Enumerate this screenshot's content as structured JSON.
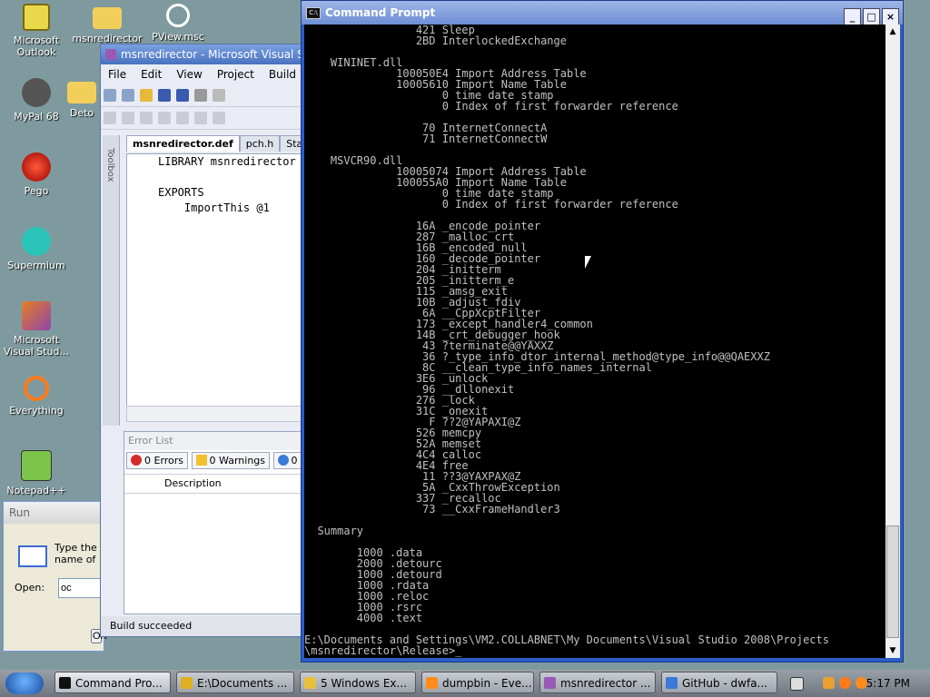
{
  "desktop": {
    "icons": [
      {
        "label": "Microsoft Outlook",
        "name": "outlook"
      },
      {
        "label": "msnredirector",
        "name": "msnredirector-folder"
      },
      {
        "label": "PView.msc",
        "name": "pview"
      },
      {
        "label": "MyPal 68",
        "name": "mypal"
      },
      {
        "label": "Deto",
        "name": "deto"
      },
      {
        "label": "Pego",
        "name": "pego"
      },
      {
        "label": "Supermium",
        "name": "supermium"
      },
      {
        "label": "Microsoft Visual Stud...",
        "name": "visual-studio"
      },
      {
        "label": "Everything",
        "name": "everything"
      },
      {
        "label": "Notepad++",
        "name": "notepadpp"
      }
    ]
  },
  "vs_window": {
    "title": "msnredirector - Microsoft Visual Studio",
    "menu": [
      "File",
      "Edit",
      "View",
      "Project",
      "Build"
    ],
    "toolbox_label": "Toolbox",
    "tabs": [
      "msnredirector.def",
      "pch.h",
      "Start Page"
    ],
    "editor_lines": [
      "LIBRARY msnredirector",
      "",
      "EXPORTS",
      "    ImportThis @1"
    ],
    "error_list": {
      "title": "Error List",
      "errors": "0 Errors",
      "warnings": "0 Warnings",
      "messages": "0",
      "column": "Description"
    },
    "status": "Build succeeded"
  },
  "run_dialog": {
    "title": "Run",
    "text": "Type the name of a program, folder, document, or Internet resource",
    "open_label": "Open:",
    "open_value": "oc",
    "ok_label": "OK"
  },
  "cmd_window": {
    "title": "Command Prompt",
    "icon_text": "C:\\",
    "lines": [
      "                 421 Sleep",
      "                 2BD InterlockedExchange",
      "",
      "    WININET.dll",
      "              100050E4 Import Address Table",
      "              10005610 Import Name Table",
      "                     0 time date stamp",
      "                     0 Index of first forwarder reference",
      "",
      "                  70 InternetConnectA",
      "                  71 InternetConnectW",
      "",
      "    MSVCR90.dll",
      "              10005074 Import Address Table",
      "              100055A0 Import Name Table",
      "                     0 time date stamp",
      "                     0 Index of first forwarder reference",
      "",
      "                 16A _encode_pointer",
      "                 287 _malloc_crt",
      "                 16B _encoded_null",
      "                 160 _decode_pointer",
      "                 204 _initterm",
      "                 205 _initterm_e",
      "                 115 _amsg_exit",
      "                 10B _adjust_fdiv",
      "                  6A __CppXcptFilter",
      "                 173 _except_handler4_common",
      "                 14B _crt_debugger_hook",
      "                  43 ?terminate@@YAXXZ",
      "                  36 ?_type_info_dtor_internal_method@type_info@@QAEXXZ",
      "                  8C __clean_type_info_names_internal",
      "                 3E6 _unlock",
      "                  96 __dllonexit",
      "                 276 _lock",
      "                 31C _onexit",
      "                   F ??2@YAPAXI@Z",
      "                 526 memcpy",
      "                 52A memset",
      "                 4C4 calloc",
      "                 4E4 free",
      "                  11 ??3@YAXPAX@Z",
      "                  5A _CxxThrowException",
      "                 337 _recalloc",
      "                  73 __CxxFrameHandler3",
      "",
      "  Summary",
      "",
      "        1000 .data",
      "        2000 .detourc",
      "        1000 .detourd",
      "        1000 .rdata",
      "        1000 .reloc",
      "        1000 .rsrc",
      "        4000 .text",
      "",
      "E:\\Documents and Settings\\VM2.COLLABNET\\My Documents\\Visual Studio 2008\\Projects",
      "\\msnredirector\\Release>_"
    ]
  },
  "taskbar": {
    "tasks": [
      {
        "label": "Command Pro...",
        "color": "#111111"
      },
      {
        "label": "E:\\Documents ...",
        "color": "#e0b020"
      },
      {
        "label": "5 Windows Ex...",
        "color": "#e8c040"
      },
      {
        "label": "dumpbin - Eve...",
        "color": "#ff8c1a"
      },
      {
        "label": "msnredirector ...",
        "color": "#9b59b6"
      },
      {
        "label": "GitHub - dwfa...",
        "color": "#3c78d8"
      }
    ],
    "clock": "5:17 PM"
  }
}
